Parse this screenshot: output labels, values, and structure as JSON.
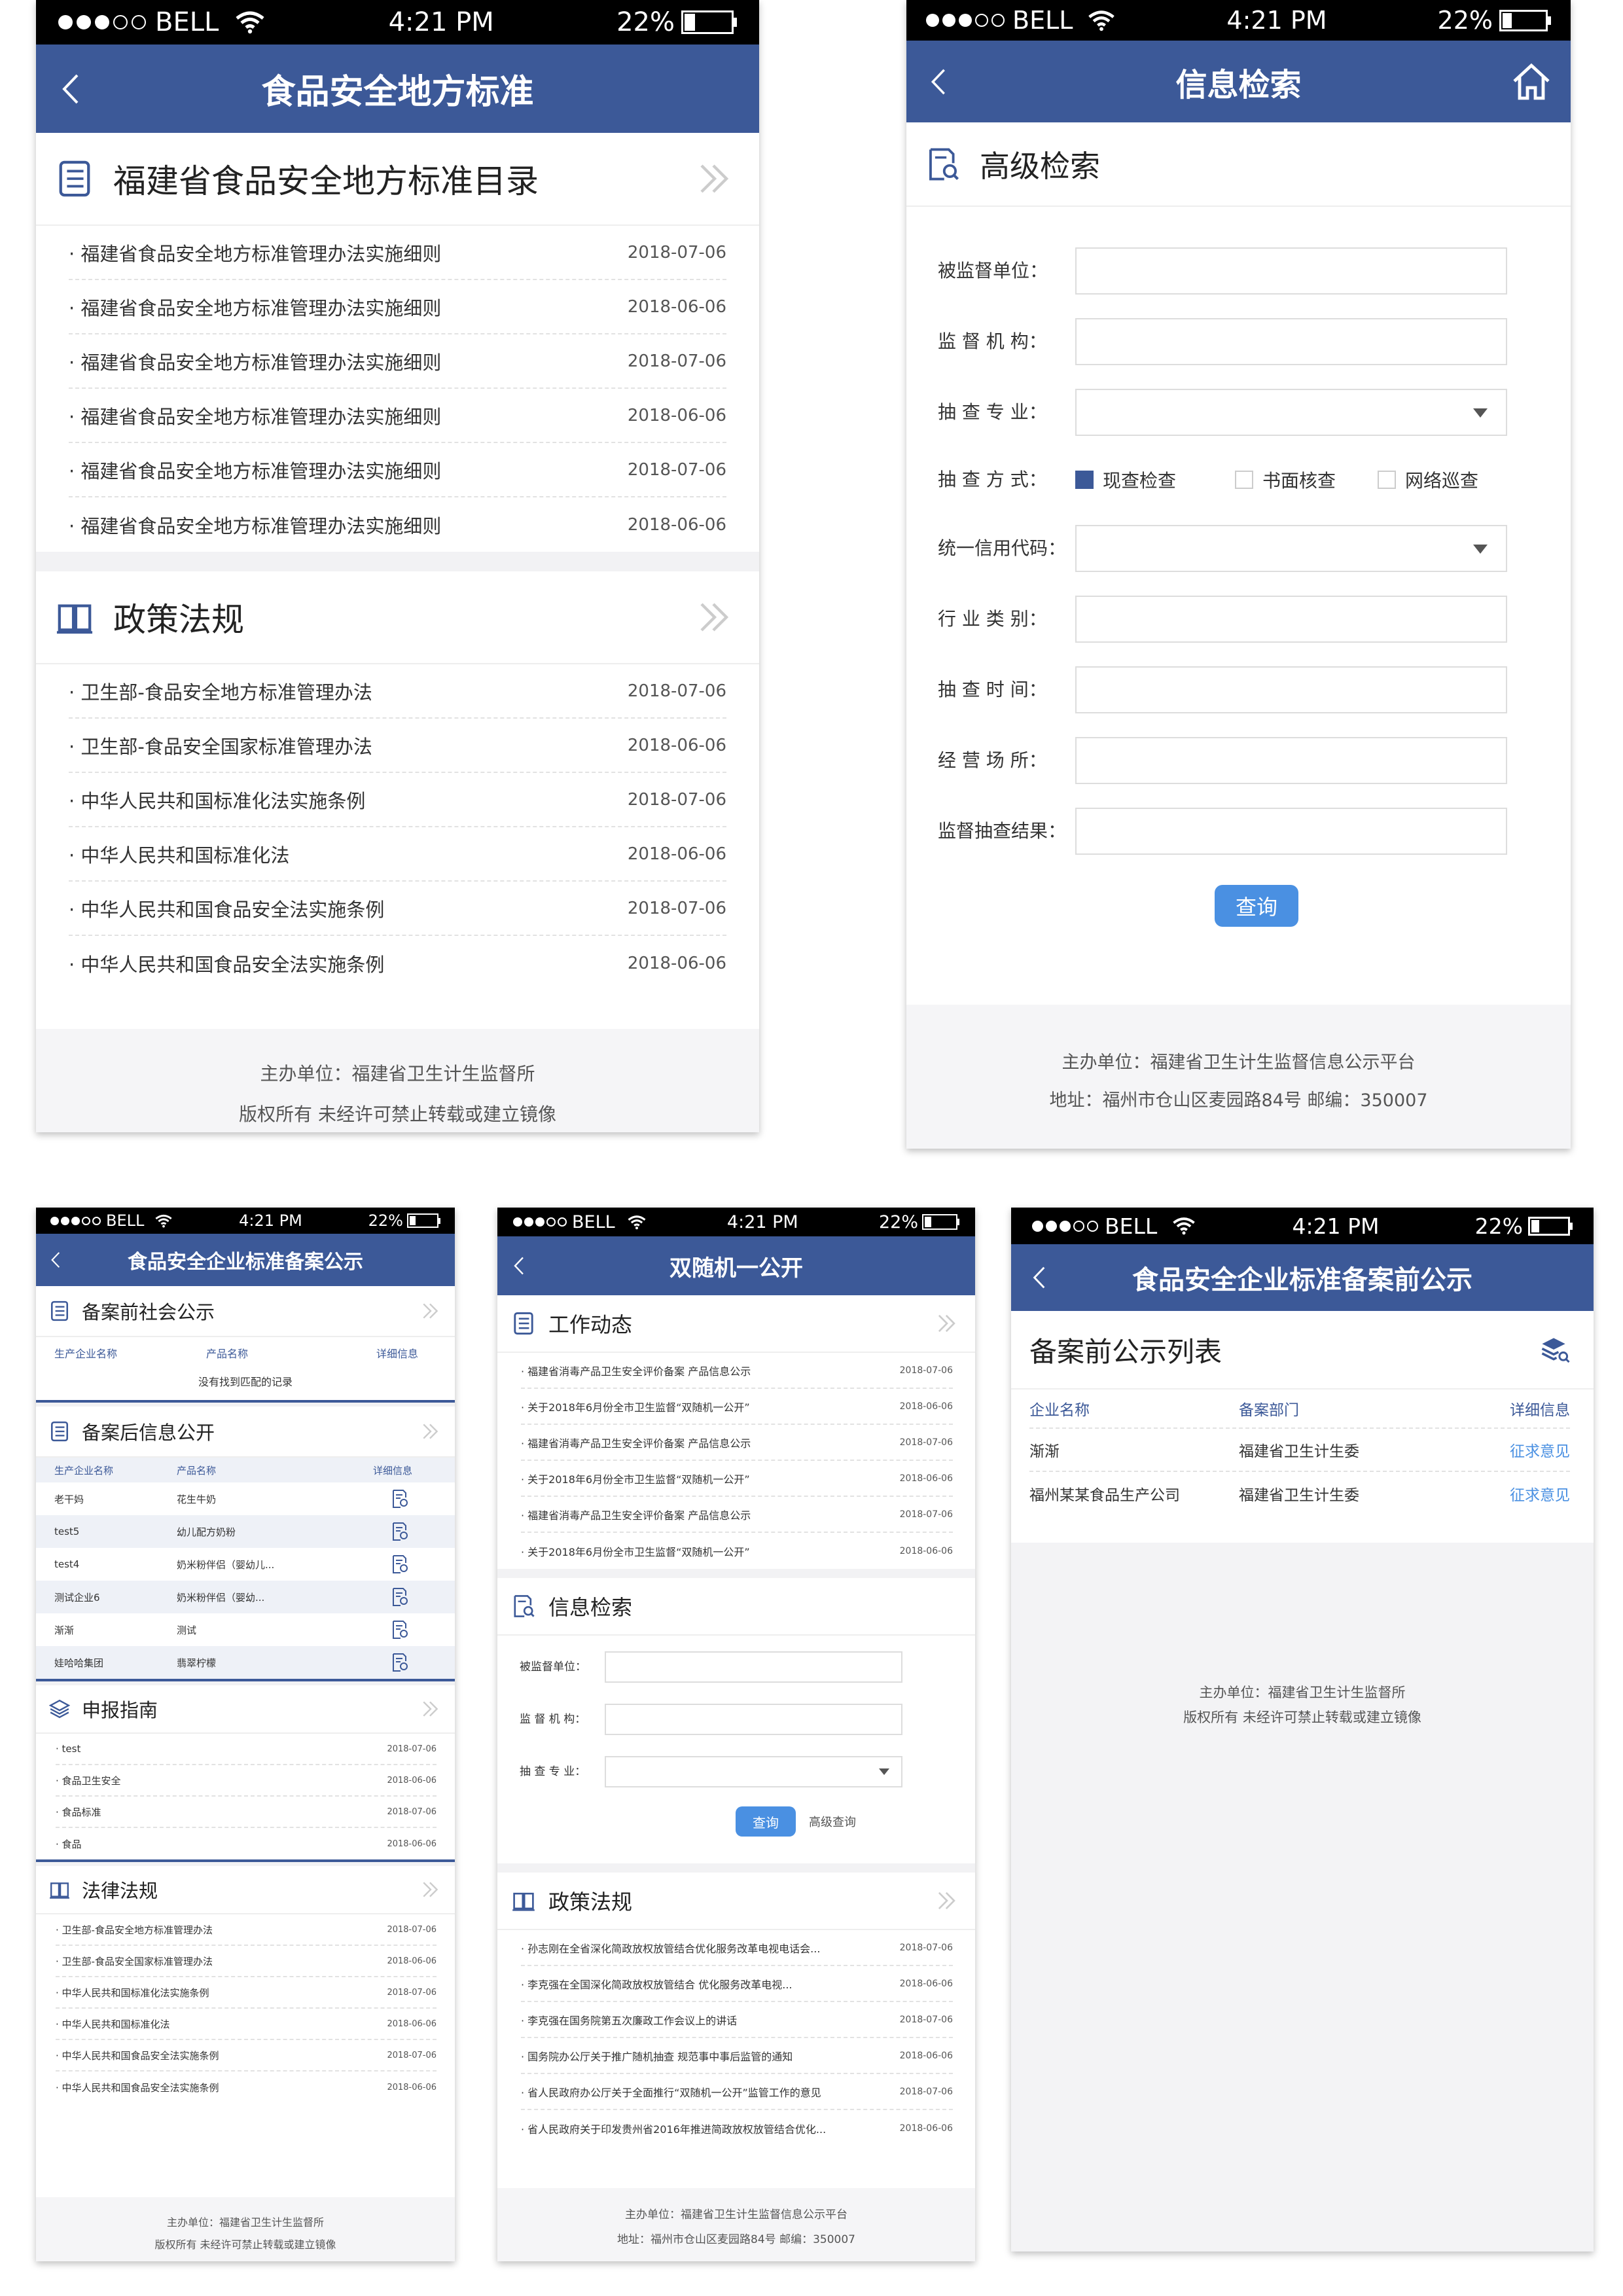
{
  "status": {
    "carrier": "BELL",
    "time": "4:21 PM",
    "battery": "22%"
  },
  "colors": {
    "nav": "#3c5998",
    "button": "#4a90e2",
    "link": "#4a90e2"
  },
  "p1": {
    "title": "食品安全地方标准",
    "sec1": {
      "title": "福建省食品安全地方标准目录",
      "items": [
        {
          "t": "福建省食品安全地方标准管理办法实施细则",
          "d": "2018-07-06"
        },
        {
          "t": "福建省食品安全地方标准管理办法实施细则",
          "d": "2018-06-06"
        },
        {
          "t": "福建省食品安全地方标准管理办法实施细则",
          "d": "2018-07-06"
        },
        {
          "t": "福建省食品安全地方标准管理办法实施细则",
          "d": "2018-06-06"
        },
        {
          "t": "福建省食品安全地方标准管理办法实施细则",
          "d": "2018-07-06"
        },
        {
          "t": "福建省食品安全地方标准管理办法实施细则",
          "d": "2018-06-06"
        }
      ]
    },
    "sec2": {
      "title": "政策法规",
      "items": [
        {
          "t": "卫生部-食品安全地方标准管理办法",
          "d": "2018-07-06"
        },
        {
          "t": "卫生部-食品安全国家标准管理办法",
          "d": "2018-06-06"
        },
        {
          "t": "中华人民共和国标准化法实施条例",
          "d": "2018-07-06"
        },
        {
          "t": "中华人民共和国标准化法",
          "d": "2018-06-06"
        },
        {
          "t": "中华人民共和国食品安全法实施条例",
          "d": "2018-07-06"
        },
        {
          "t": "中华人民共和国食品安全法实施条例",
          "d": "2018-06-06"
        }
      ]
    },
    "footer": {
      "line1": "主办单位：福建省卫生计生监督所",
      "line2": "版权所有 未经许可禁止转载或建立镜像"
    }
  },
  "p2": {
    "title": "信息检索",
    "section": "高级检索",
    "fields": {
      "unit": "被监督单位：",
      "org": "监 督 机 构：",
      "major": "抽 查 专 业：",
      "method": "抽 查 方 式：",
      "credit": "统一信用代码：",
      "industry": "行 业 类 别：",
      "time": "抽 查 时 间：",
      "place": "经 营 场 所：",
      "result": "监督抽查结果："
    },
    "methods": [
      "现查检查",
      "书面核查",
      "网络巡查"
    ],
    "query": "查询",
    "footer": {
      "line1": "主办单位：福建省卫生计生监督信息公示平台",
      "line2": "地址：福州市仓山区麦园路84号 邮编：350007"
    }
  },
  "p3": {
    "title": "食品安全企业标准备案公示",
    "sec1": {
      "title": "备案前社会公示",
      "cols": [
        "生产企业名称",
        "产品名称",
        "详细信息"
      ],
      "empty": "没有找到匹配的记录"
    },
    "sec2": {
      "title": "备案后信息公开",
      "cols": [
        "生产企业名称",
        "产品名称",
        "详细信息"
      ],
      "rows": [
        {
          "a": "老干妈",
          "b": "花生牛奶"
        },
        {
          "a": "test5",
          "b": "幼儿配方奶粉"
        },
        {
          "a": "test4",
          "b": "奶米粉伴侣（婴幼儿..."
        },
        {
          "a": "测试企业6",
          "b": "奶米粉伴侣（婴幼..."
        },
        {
          "a": "渐渐",
          "b": "测试"
        },
        {
          "a": "娃哈哈集团",
          "b": "翡翠柠檬"
        }
      ]
    },
    "sec3": {
      "title": "申报指南",
      "items": [
        {
          "t": "test",
          "d": "2018-07-06"
        },
        {
          "t": "食品卫生安全",
          "d": "2018-06-06"
        },
        {
          "t": "食品标准",
          "d": "2018-07-06"
        },
        {
          "t": "食品",
          "d": "2018-06-06"
        }
      ]
    },
    "sec4": {
      "title": "法律法规",
      "items": [
        {
          "t": "卫生部-食品安全地方标准管理办法",
          "d": "2018-07-06"
        },
        {
          "t": "卫生部-食品安全国家标准管理办法",
          "d": "2018-06-06"
        },
        {
          "t": "中华人民共和国标准化法实施条例",
          "d": "2018-07-06"
        },
        {
          "t": "中华人民共和国标准化法",
          "d": "2018-06-06"
        },
        {
          "t": "中华人民共和国食品安全法实施条例",
          "d": "2018-07-06"
        },
        {
          "t": "中华人民共和国食品安全法实施条例",
          "d": "2018-06-06"
        }
      ]
    },
    "footer": {
      "line1": "主办单位：福建省卫生计生监督所",
      "line2": "版权所有 未经许可禁止转载或建立镜像"
    }
  },
  "p4": {
    "title": "双随机一公开",
    "sec1": {
      "title": "工作动态",
      "items": [
        {
          "t": "福建省消毒产品卫生安全评价备案 产品信息公示",
          "d": "2018-07-06"
        },
        {
          "t": "关于2018年6月份全市卫生监督“双随机一公开”",
          "d": "2018-06-06"
        },
        {
          "t": "福建省消毒产品卫生安全评价备案 产品信息公示",
          "d": "2018-07-06"
        },
        {
          "t": "关于2018年6月份全市卫生监督“双随机一公开”",
          "d": "2018-06-06"
        },
        {
          "t": "福建省消毒产品卫生安全评价备案 产品信息公示",
          "d": "2018-07-06"
        },
        {
          "t": "关于2018年6月份全市卫生监督“双随机一公开”",
          "d": "2018-06-06"
        }
      ]
    },
    "sec2": {
      "title": "信息检索",
      "f1": "被监督单位：",
      "f2": "监 督 机 构：",
      "f3": "抽 查 专 业：",
      "query": "查询",
      "advanced": "高级查询"
    },
    "sec3": {
      "title": "政策法规",
      "items": [
        {
          "t": "孙志刚在全省深化简政放权放管结合优化服务改革电视电话会...",
          "d": "2018-07-06"
        },
        {
          "t": "李克强在全国深化简政放权放管结合 优化服务改革电视...",
          "d": "2018-06-06"
        },
        {
          "t": "李克强在国务院第五次廉政工作会议上的讲话",
          "d": "2018-07-06"
        },
        {
          "t": "国务院办公厅关于推广随机抽查 规范事中事后监管的通知",
          "d": "2018-06-06"
        },
        {
          "t": "省人民政府办公厅关于全面推行“双随机一公开”监管工作的意见",
          "d": "2018-07-06"
        },
        {
          "t": "省人民政府关于印发贵州省2016年推进简政放权放管结合优化...",
          "d": "2018-06-06"
        }
      ]
    },
    "footer": {
      "line1": "主办单位：福建省卫生计生监督信息公示平台",
      "line2": "地址：福州市仓山区麦园路84号 邮编：350007"
    }
  },
  "p5": {
    "title": "食品安全企业标准备案前公示",
    "section": "备案前公示列表",
    "cols": [
      "企业名称",
      "备案部门",
      "详细信息"
    ],
    "rows": [
      {
        "a": "渐渐",
        "b": "福建省卫生计生委",
        "c": "征求意见"
      },
      {
        "a": "福州某某食品生产公司",
        "b": "福建省卫生计生委",
        "c": "征求意见"
      }
    ],
    "footer": {
      "line1": "主办单位：福建省卫生计生监督所",
      "line2": "版权所有 未经许可禁止转载或建立镜像"
    }
  }
}
